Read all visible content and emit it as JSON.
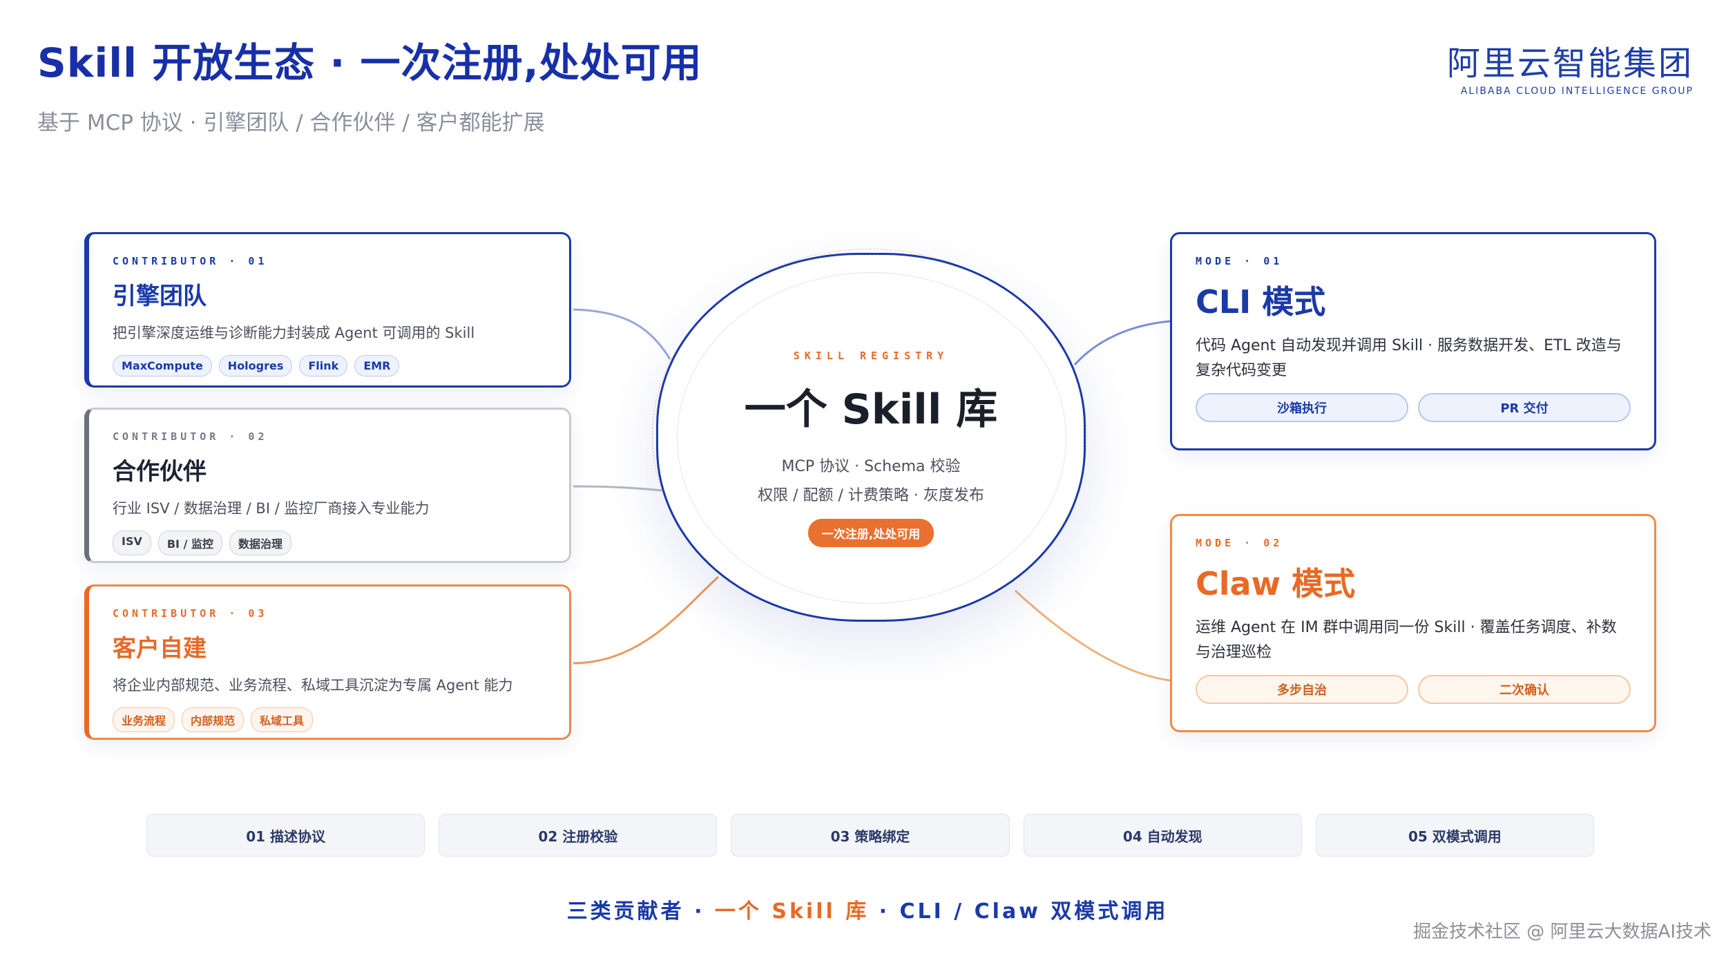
{
  "header": {
    "title": "Skill 开放生态 · 一次注册,处处可用",
    "subtitle": "基于 MCP 协议 · 引擎团队 / 合作伙伴 / 客户都能扩展"
  },
  "logo": {
    "cn": "阿里云智能集团",
    "en": "ALIBABA CLOUD INTELLIGENCE GROUP"
  },
  "contributors": [
    {
      "kicker": "CONTRIBUTOR · 01",
      "title": "引擎团队",
      "desc": "把引擎深度运维与诊断能力封装成 Agent 可调用的 Skill",
      "tags": [
        "MaxCompute",
        "Hologres",
        "Flink",
        "EMR"
      ],
      "color": "#1a3aa8"
    },
    {
      "kicker": "CONTRIBUTOR · 02",
      "title": "合作伙伴",
      "desc": "行业 ISV / 数据治理 / BI / 监控厂商接入专业能力",
      "tags": [
        "ISV",
        "BI / 监控",
        "数据治理"
      ],
      "color": "#6c707a"
    },
    {
      "kicker": "CONTRIBUTOR · 03",
      "title": "客户自建",
      "desc": "将企业内部规范、业务流程、私域工具沉淀为专属 Agent 能力",
      "tags": [
        "业务流程",
        "内部规范",
        "私域工具"
      ],
      "color": "#e76a26"
    }
  ],
  "hub": {
    "kicker": "SKILL REGISTRY",
    "title": "一个 Skill 库",
    "line1": "MCP 协议 · Schema 校验",
    "line2": "权限 / 配额 / 计费策略 · 灰度发布",
    "pill": "一次注册,处处可用"
  },
  "modes": [
    {
      "kicker": "MODE · 01",
      "title": "CLI 模式",
      "desc": "代码 Agent 自动发现并调用 Skill · 服务数据开发、ETL 改造与复杂代码变更",
      "buttons": [
        "沙箱执行",
        "PR 交付"
      ],
      "color": "#1a3aa8"
    },
    {
      "kicker": "MODE · 02",
      "title": "Claw 模式",
      "desc": "运维 Agent 在 IM 群中调用同一份 Skill · 覆盖任务调度、补数与治理巡检",
      "buttons": [
        "多步自治",
        "二次确认"
      ],
      "color": "#e76a26"
    }
  ],
  "steps": [
    "01 描述协议",
    "02 注册校验",
    "03 策略绑定",
    "04 自动发现",
    "05 双模式调用"
  ],
  "tagline": {
    "part1": "三类贡献者 · ",
    "part2": "一个 Skill 库",
    "part3": " · CLI / Claw 双模式调用"
  },
  "watermark": "掘金技术社区 @ 阿里云大数据AI技术"
}
